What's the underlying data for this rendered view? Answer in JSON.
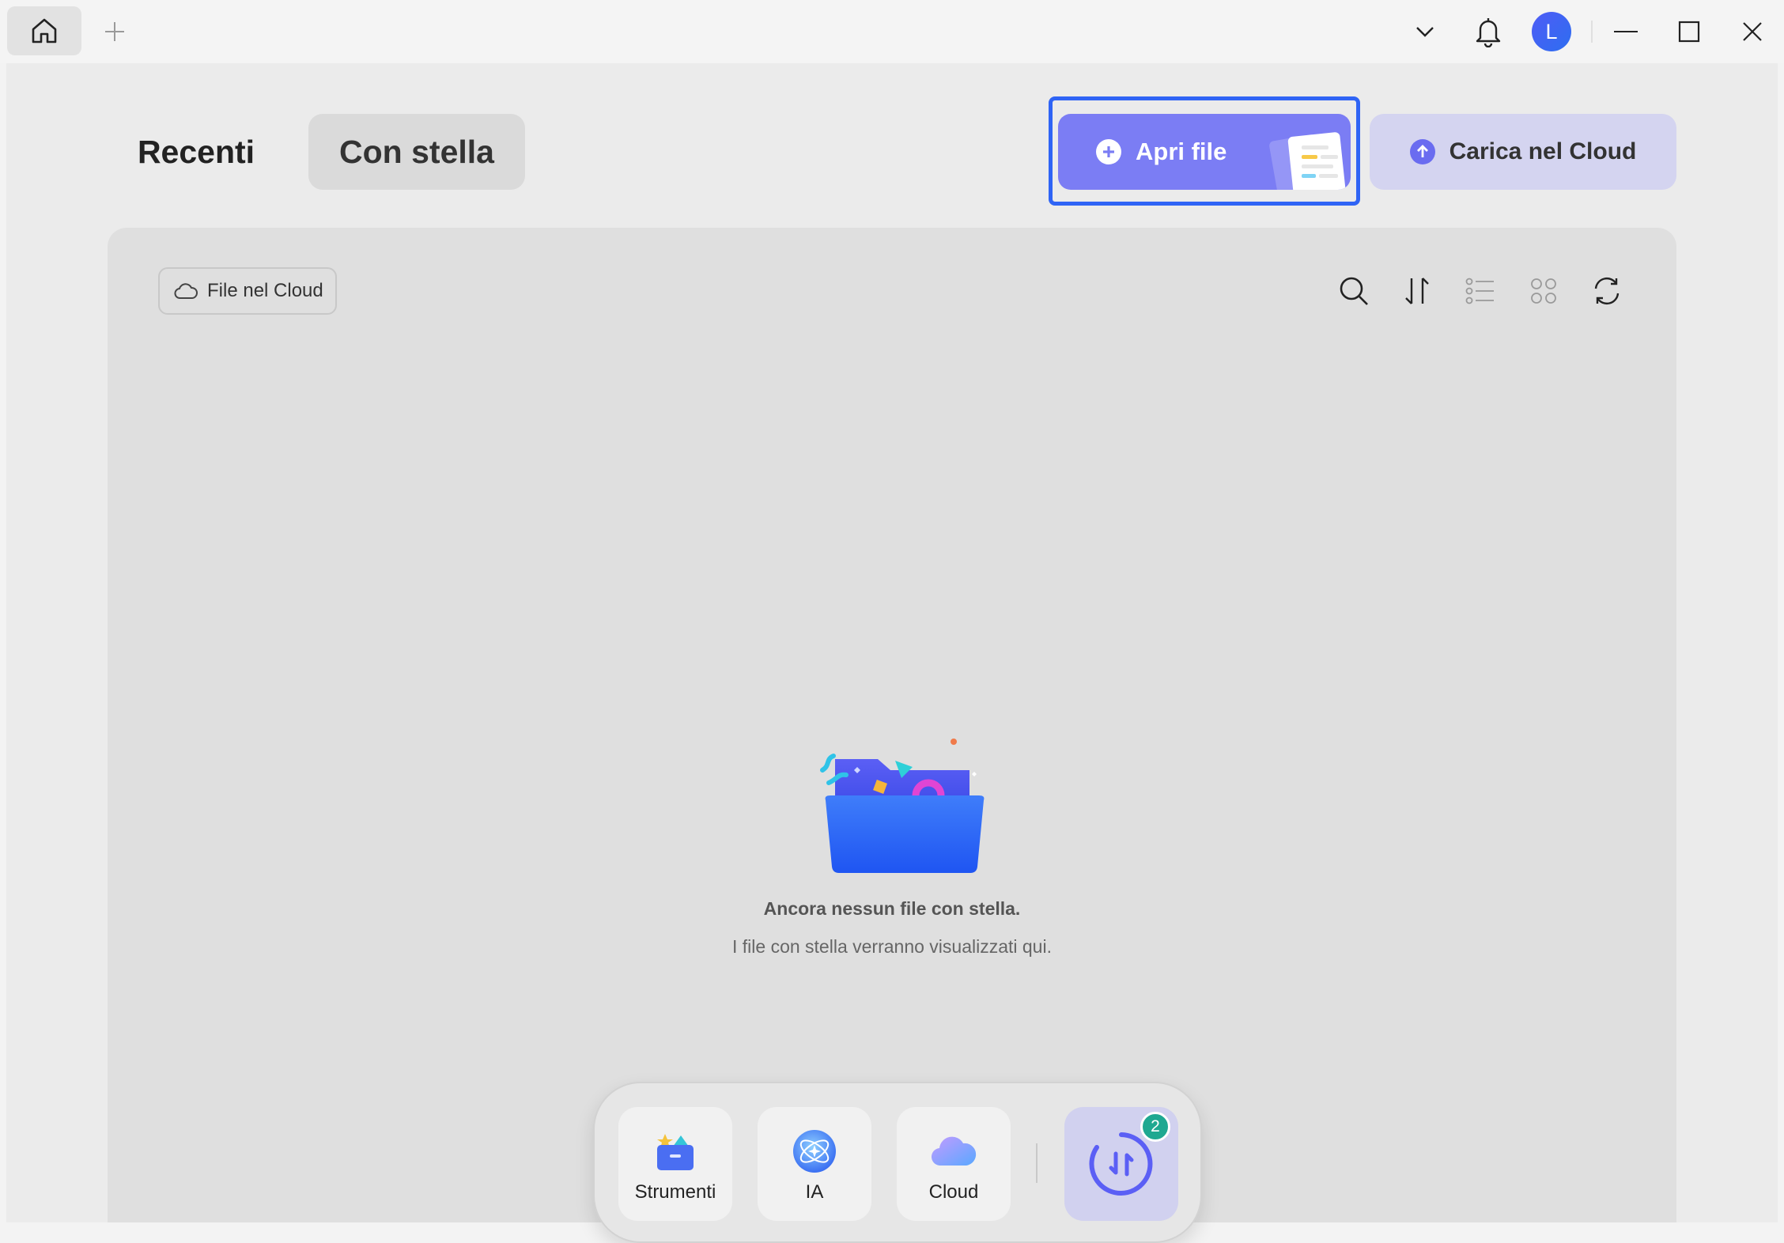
{
  "titlebar": {
    "avatar_letter": "L",
    "icons": [
      "home-icon",
      "plus-icon",
      "chevron-down-icon",
      "bell-icon",
      "minimize-icon",
      "maximize-icon",
      "close-icon"
    ]
  },
  "tabs": {
    "recent_label": "Recenti",
    "starred_label": "Con stella"
  },
  "actions": {
    "open_label": "Apri file",
    "upload_label": "Carica nel Cloud"
  },
  "panel": {
    "filter_chip_label": "File nel Cloud",
    "tools": [
      "search-icon",
      "sort-icon",
      "list-view-icon",
      "grid-view-icon",
      "refresh-icon"
    ],
    "empty_title": "Ancora nessun file con stella.",
    "empty_subtitle": "I file con stella verranno visualizzati qui."
  },
  "dock": {
    "items": [
      {
        "label": "Strumenti",
        "icon": "toolbox-icon"
      },
      {
        "label": "IA",
        "icon": "ai-orb-icon"
      },
      {
        "label": "Cloud",
        "icon": "cloud-icon"
      }
    ],
    "convert_badge": "2"
  },
  "colors": {
    "accent": "#7b7df4",
    "focus": "#2f64f5",
    "upload_bg": "#d4d4f0",
    "badge": "#1ea891"
  }
}
